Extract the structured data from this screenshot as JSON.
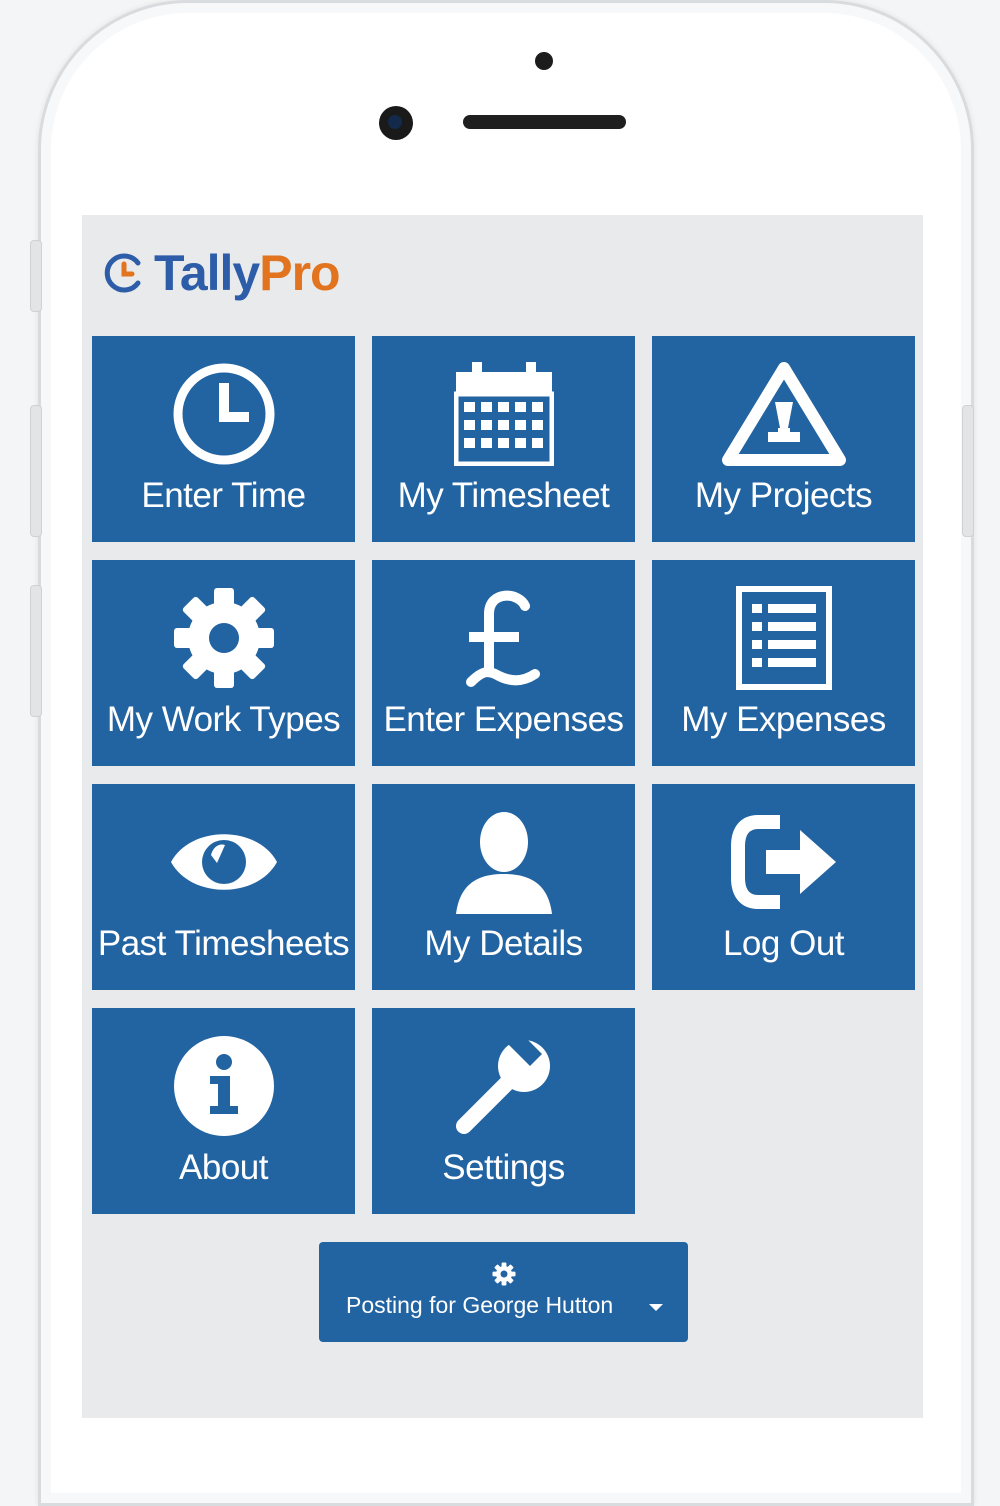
{
  "app": {
    "brand_main": "Tally",
    "brand_accent": "Pro",
    "colors": {
      "tile": "#2263a1",
      "brand_blue": "#2d5ca8",
      "brand_orange": "#e2741f",
      "screen_bg": "#e8eaeb"
    }
  },
  "menu": {
    "tiles": [
      {
        "label": "Enter Time",
        "icon": "clock-icon"
      },
      {
        "label": "My Timesheet",
        "icon": "calendar-icon"
      },
      {
        "label": "My Projects",
        "icon": "warning-triangle-icon"
      },
      {
        "label": "My Work Types",
        "icon": "gear-icon"
      },
      {
        "label": "Enter Expenses",
        "icon": "pound-icon"
      },
      {
        "label": "My Expenses",
        "icon": "list-document-icon"
      },
      {
        "label": "Past Timesheets",
        "icon": "eye-icon"
      },
      {
        "label": "My Details",
        "icon": "user-icon"
      },
      {
        "label": "Log Out",
        "icon": "logout-icon"
      },
      {
        "label": "About",
        "icon": "info-icon"
      },
      {
        "label": "Settings",
        "icon": "wrench-icon"
      }
    ]
  },
  "posting": {
    "label": "Posting for George Hutton",
    "icon": "gear-icon"
  }
}
